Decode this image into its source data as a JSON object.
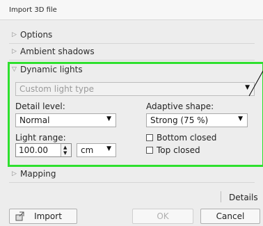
{
  "window": {
    "title": "Import 3D file"
  },
  "sections": {
    "options": "Options",
    "ambient_shadows": "Ambient shadows",
    "dynamic_lights": "Dynamic lights",
    "mapping": "Mapping"
  },
  "dynamic": {
    "light_type_value": "Custom light type",
    "detail_level_label": "Detail level:",
    "detail_level_value": "Normal",
    "adaptive_shape_label": "Adaptive shape:",
    "adaptive_shape_value": "Strong (75 %)",
    "light_range_label": "Light range:",
    "light_range_value": "100.00",
    "unit_value": "cm",
    "bottom_closed_label": "Bottom closed",
    "top_closed_label": "Top closed"
  },
  "footer": {
    "details_label": "Details",
    "import_label": "Import",
    "ok_label": "OK",
    "cancel_label": "Cancel"
  },
  "colors": {
    "highlight": "#2ee02e"
  },
  "icons": {
    "section_collapsed": "triangle-right-icon",
    "section_expanded": "triangle-down-icon",
    "dropdown": "caret-down-icon",
    "import": "import-icon"
  }
}
